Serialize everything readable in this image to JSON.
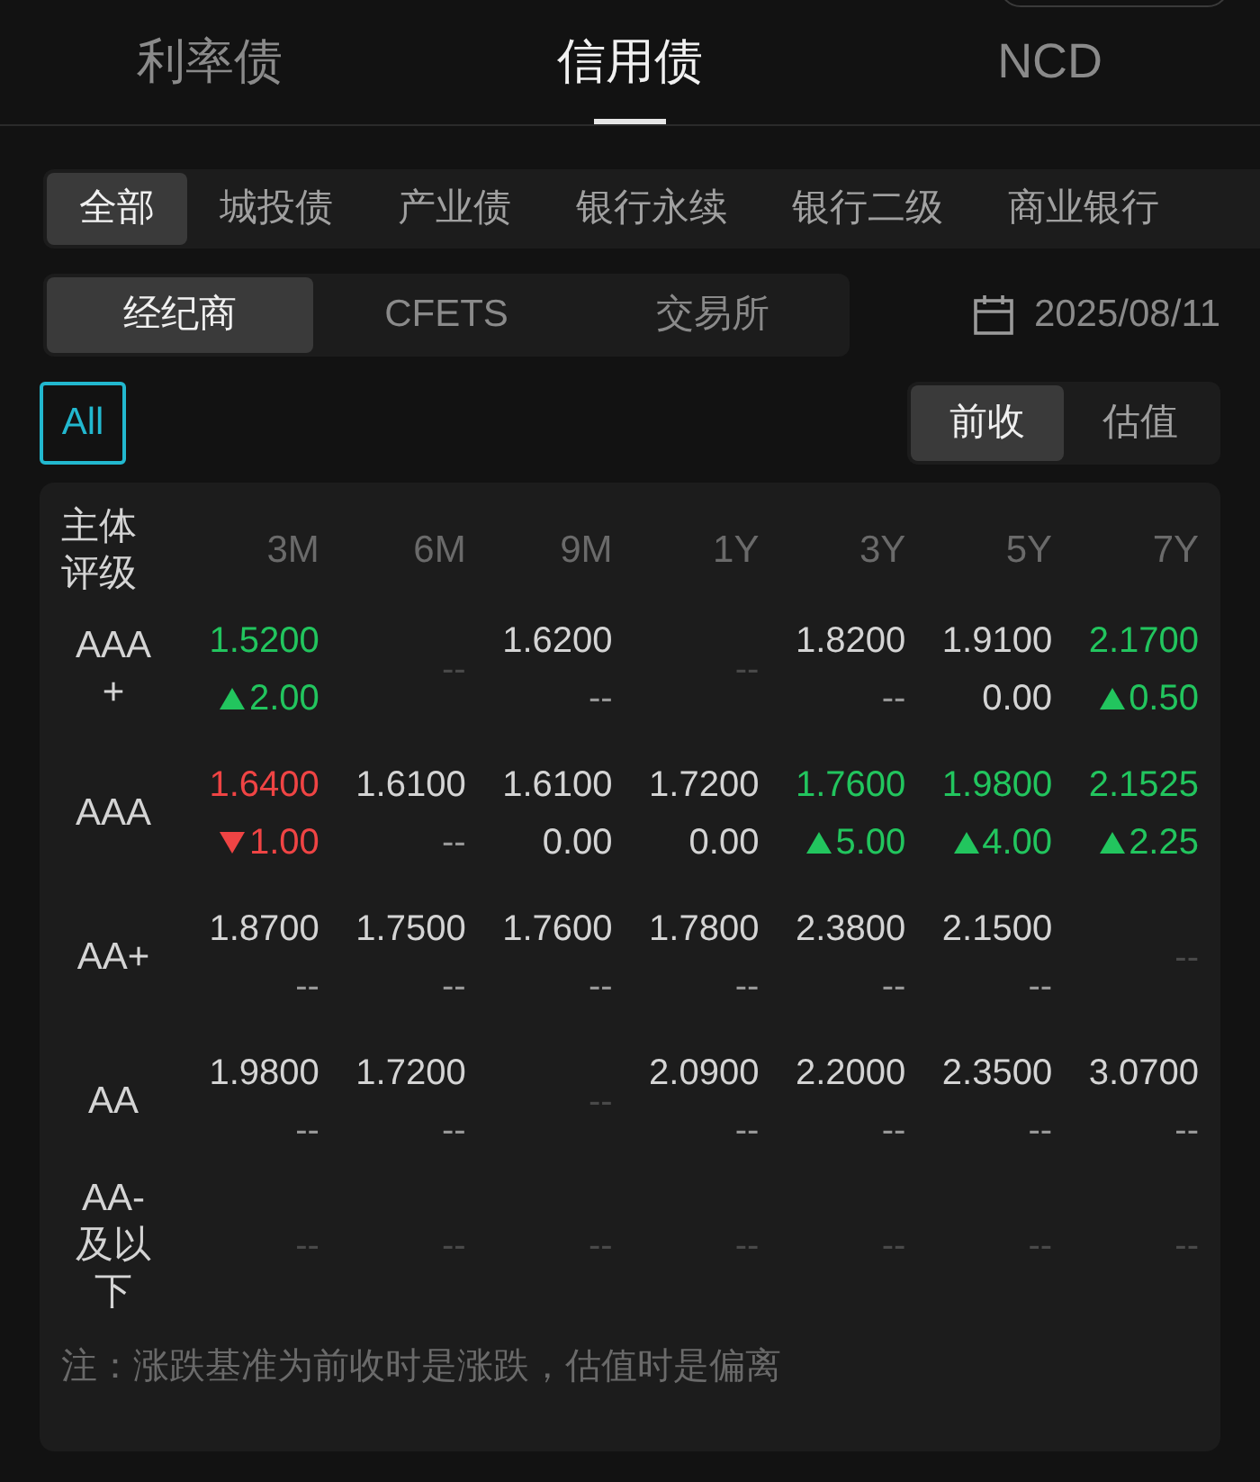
{
  "top_tabs": [
    {
      "label": "利率债",
      "selected": false
    },
    {
      "label": "信用债",
      "selected": true
    },
    {
      "label": "NCD",
      "selected": false
    }
  ],
  "categories": [
    {
      "label": "全部",
      "selected": true
    },
    {
      "label": "城投债",
      "selected": false
    },
    {
      "label": "产业债",
      "selected": false
    },
    {
      "label": "银行永续",
      "selected": false
    },
    {
      "label": "银行二级",
      "selected": false
    },
    {
      "label": "商业银行",
      "selected": false
    }
  ],
  "sources": [
    {
      "label": "经纪商",
      "selected": true
    },
    {
      "label": "CFETS",
      "selected": false
    },
    {
      "label": "交易所",
      "selected": false
    }
  ],
  "date": "2025/08/11",
  "all_button": {
    "label": "All",
    "selected": true
  },
  "basis": [
    {
      "label": "前收",
      "selected": true
    },
    {
      "label": "估值",
      "selected": false
    }
  ],
  "table": {
    "corner": [
      "主体",
      "评级"
    ],
    "columns": [
      "3M",
      "6M",
      "9M",
      "1Y",
      "3Y",
      "5Y",
      "7Y"
    ],
    "rows": [
      {
        "rating": [
          "AAA",
          "+"
        ],
        "cells": [
          {
            "kind": "rise",
            "value": "1.5200",
            "change": "2.00"
          },
          {
            "kind": "empty",
            "text": "--"
          },
          {
            "kind": "flat",
            "value": "1.6200",
            "change": "--"
          },
          {
            "kind": "empty",
            "text": "--"
          },
          {
            "kind": "flat",
            "value": "1.8200",
            "change": "--"
          },
          {
            "kind": "flat",
            "value": "1.9100",
            "change": "0.00"
          },
          {
            "kind": "rise",
            "value": "2.1700",
            "change": "0.50"
          }
        ]
      },
      {
        "rating": [
          "AAA"
        ],
        "cells": [
          {
            "kind": "fall",
            "value": "1.6400",
            "change": "1.00"
          },
          {
            "kind": "flat",
            "value": "1.6100",
            "change": "--"
          },
          {
            "kind": "flat",
            "value": "1.6100",
            "change": "0.00"
          },
          {
            "kind": "flat",
            "value": "1.7200",
            "change": "0.00"
          },
          {
            "kind": "rise",
            "value": "1.7600",
            "change": "5.00"
          },
          {
            "kind": "rise",
            "value": "1.9800",
            "change": "4.00"
          },
          {
            "kind": "rise",
            "value": "2.1525",
            "change": "2.25"
          }
        ]
      },
      {
        "rating": [
          "AA+"
        ],
        "cells": [
          {
            "kind": "flat",
            "value": "1.8700",
            "change": "--"
          },
          {
            "kind": "flat",
            "value": "1.7500",
            "change": "--"
          },
          {
            "kind": "flat",
            "value": "1.7600",
            "change": "--"
          },
          {
            "kind": "flat",
            "value": "1.7800",
            "change": "--"
          },
          {
            "kind": "flat",
            "value": "2.3800",
            "change": "--"
          },
          {
            "kind": "flat",
            "value": "2.1500",
            "change": "--"
          },
          {
            "kind": "empty",
            "text": "--"
          }
        ]
      },
      {
        "rating": [
          "AA"
        ],
        "cells": [
          {
            "kind": "flat",
            "value": "1.9800",
            "change": "--"
          },
          {
            "kind": "flat",
            "value": "1.7200",
            "change": "--"
          },
          {
            "kind": "empty",
            "text": "--"
          },
          {
            "kind": "flat",
            "value": "2.0900",
            "change": "--"
          },
          {
            "kind": "flat",
            "value": "2.2000",
            "change": "--"
          },
          {
            "kind": "flat",
            "value": "2.3500",
            "change": "--"
          },
          {
            "kind": "flat",
            "value": "3.0700",
            "change": "--"
          }
        ]
      },
      {
        "rating": [
          "AA-",
          "及以",
          "下"
        ],
        "cells": [
          {
            "kind": "empty",
            "text": "--"
          },
          {
            "kind": "empty",
            "text": "--"
          },
          {
            "kind": "empty",
            "text": "--"
          },
          {
            "kind": "empty",
            "text": "--"
          },
          {
            "kind": "empty",
            "text": "--"
          },
          {
            "kind": "empty",
            "text": "--"
          },
          {
            "kind": "empty",
            "text": "--"
          }
        ]
      }
    ],
    "note": "注：涨跌基准为前收时是涨跌，估值时是偏离"
  }
}
